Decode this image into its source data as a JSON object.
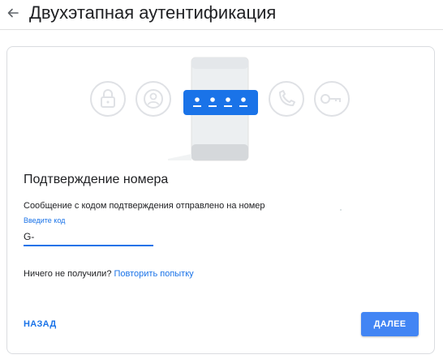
{
  "header": {
    "title": "Двухэтапная аутентификация",
    "back_icon": "arrow-back-icon"
  },
  "illustration": {
    "icons": [
      "lock-icon",
      "account-icon",
      "phone-icon",
      "key-icon"
    ],
    "accent_color": "#1a73e8"
  },
  "verify": {
    "title": "Подтверждение номера",
    "message": "Сообщение с кодом подтверждения отправлено на номер",
    "input_label": "Введите код",
    "input_value": "G-",
    "no_code_text": "Ничего не получили?",
    "retry_link": "Повторить попытку"
  },
  "actions": {
    "back_label": "НАЗАД",
    "next_label": "ДАЛЕЕ"
  },
  "colors": {
    "primary": "#4285f4",
    "link": "#1a73e8",
    "text": "#202124",
    "border": "#dadce0"
  }
}
